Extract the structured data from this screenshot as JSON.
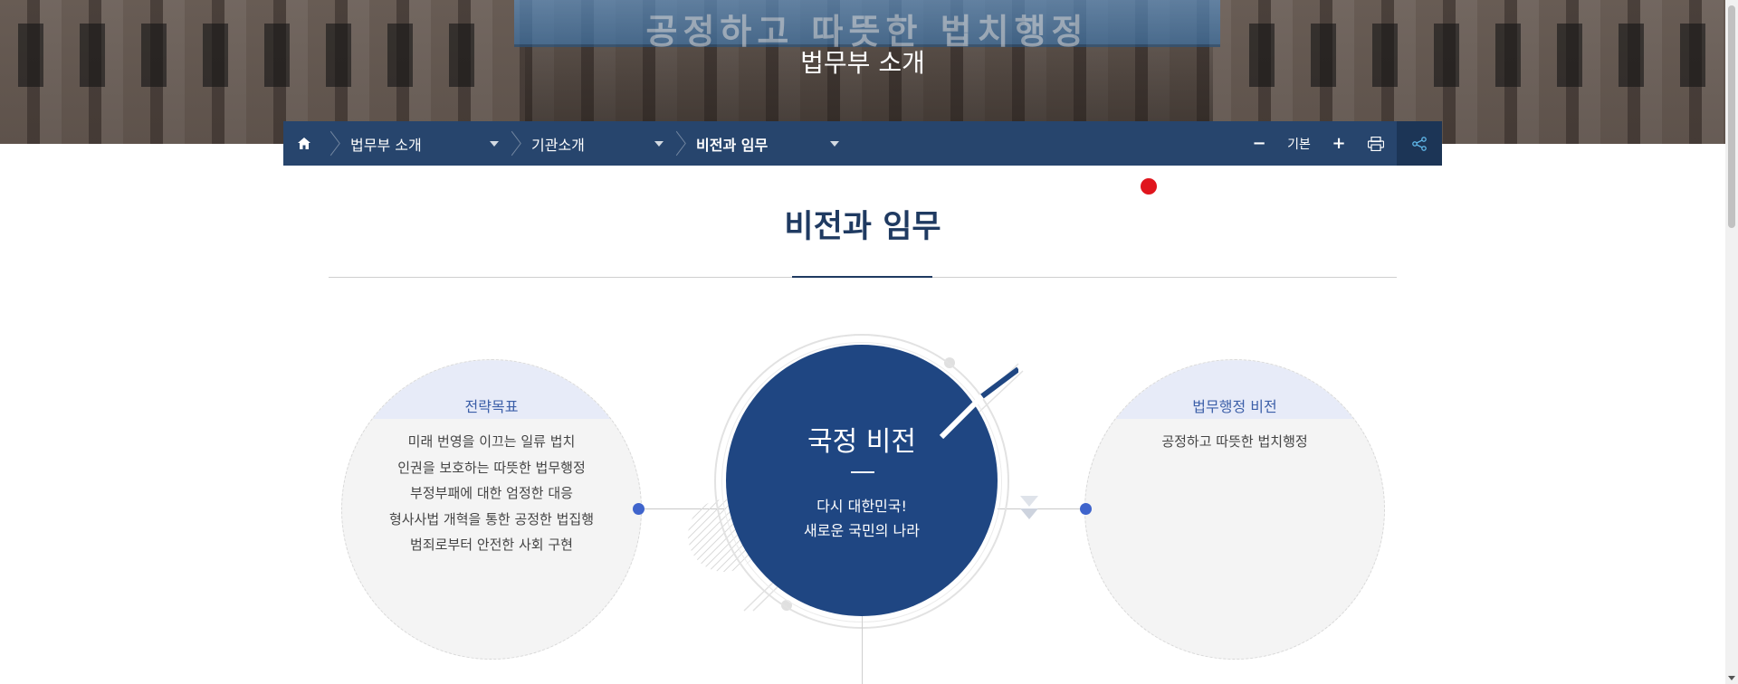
{
  "hero": {
    "title": "법무부 소개",
    "sign_text": "공정하고 따뜻한 법치행정"
  },
  "navbar": {
    "home_icon": "home-icon",
    "crumbs": [
      {
        "label": "법무부 소개"
      },
      {
        "label": "기관소개"
      },
      {
        "label": "비전과 임무"
      }
    ],
    "font_label": "기본",
    "minus_symbol": "−",
    "plus_symbol": "+",
    "colors": {
      "bar": "#27456d",
      "share_bg": "#1c3556"
    }
  },
  "page": {
    "title": "비전과 임무"
  },
  "left_circle": {
    "title": "전략목표",
    "items": [
      "미래 번영을 이끄는 일류 법치",
      "인권을 보호하는 따뜻한 법무행정",
      "부정부패에 대한 엄정한 대응",
      "형사사법 개혁을 통한 공정한 법집행",
      "범죄로부터 안전한 사회 구현"
    ]
  },
  "center": {
    "title": "국정 비전",
    "line1": "다시 대한민국!",
    "line2": "새로운 국민의 나라",
    "color": "#1f4682"
  },
  "right_circle": {
    "title": "법무행정 비전",
    "items": [
      "공정하고 따뜻한 법치행정"
    ]
  },
  "accent_colors": {
    "title": "#1f3a61",
    "dot": "#3f64cc",
    "marker": "#e0151d"
  }
}
